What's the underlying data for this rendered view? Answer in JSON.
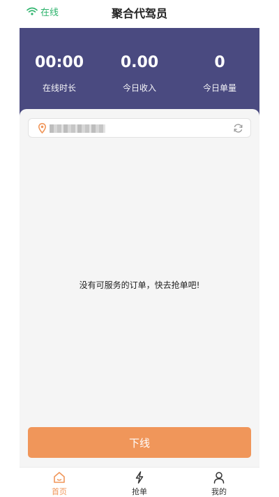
{
  "header": {
    "status_label": "在线",
    "title": "聚合代驾员"
  },
  "stats": [
    {
      "value": "00:00",
      "label": "在线时长"
    },
    {
      "value": "0.00",
      "label": "今日收入"
    },
    {
      "value": "0",
      "label": "今日单量"
    }
  ],
  "location": {
    "address": ""
  },
  "empty_message": "没有可服务的订单，快去抢单吧!",
  "offline_button": "下线",
  "tabs": [
    {
      "label": "首页",
      "icon": "home-icon",
      "active": true
    },
    {
      "label": "抢单",
      "icon": "lightning-icon",
      "active": false
    },
    {
      "label": "我的",
      "icon": "user-icon",
      "active": false
    }
  ],
  "colors": {
    "accent": "#f0965a",
    "online": "#2db36c",
    "stats_bg": "#4a4a80"
  }
}
